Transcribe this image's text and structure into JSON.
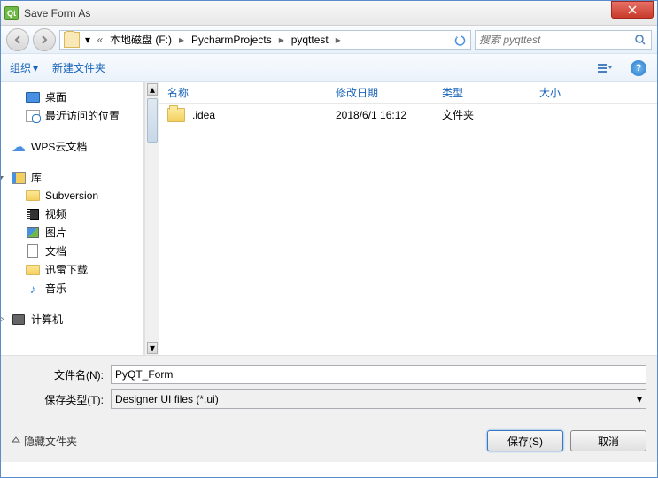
{
  "window": {
    "title": "Save Form As"
  },
  "breadcrumb": {
    "items": [
      "本地磁盘 (F:)",
      "PycharmProjects",
      "pyqttest"
    ]
  },
  "search": {
    "placeholder": "搜索 pyqttest"
  },
  "toolbar": {
    "organize": "组织",
    "newfolder": "新建文件夹"
  },
  "sidebar": {
    "quick": [
      {
        "label": "桌面",
        "icon": "desktop"
      },
      {
        "label": "最近访问的位置",
        "icon": "recent"
      }
    ],
    "cloud": {
      "label": "WPS云文档"
    },
    "lib": {
      "label": "库",
      "children": [
        {
          "label": "Subversion",
          "icon": "folder"
        },
        {
          "label": "视频",
          "icon": "video"
        },
        {
          "label": "图片",
          "icon": "pic"
        },
        {
          "label": "文档",
          "icon": "doc"
        },
        {
          "label": "迅雷下载",
          "icon": "folder"
        },
        {
          "label": "音乐",
          "icon": "music"
        }
      ]
    },
    "computer": {
      "label": "计算机"
    }
  },
  "columns": {
    "name": "名称",
    "date": "修改日期",
    "type": "类型",
    "size": "大小"
  },
  "files": [
    {
      "name": ".idea",
      "date": "2018/6/1 16:12",
      "type": "文件夹",
      "size": ""
    }
  ],
  "form": {
    "filename_label": "文件名(N):",
    "filename_value": "PyQT_Form",
    "filetype_label": "保存类型(T):",
    "filetype_value": "Designer UI files (*.ui)"
  },
  "footer": {
    "hide_folders": "隐藏文件夹",
    "save": "保存(S)",
    "cancel": "取消"
  }
}
